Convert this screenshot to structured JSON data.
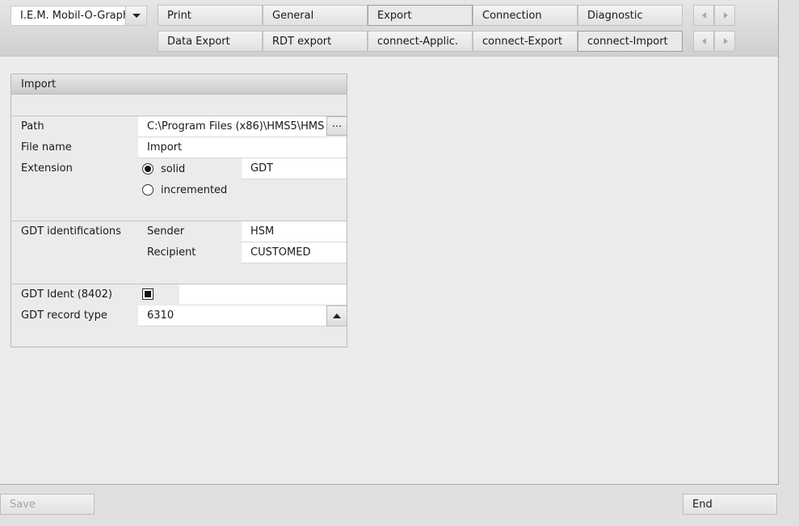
{
  "device": {
    "selected": "I.E.M. Mobil-O-Graph"
  },
  "tabs_row1": [
    "Print",
    "General",
    "Export",
    "Connection",
    "Diagnostic"
  ],
  "tabs_row2": [
    "Data Export",
    "RDT export",
    "connect-Applic.",
    "connect-Export",
    "connect-Import"
  ],
  "active_tab_row1": "Export",
  "active_tab_row2": "connect-Import",
  "panel": {
    "title": "Import",
    "path_label": "Path",
    "path_value": "C:\\Program Files (x86)\\HMS5\\HMS",
    "browse_label": "...",
    "filename_label": "File name",
    "filename_value": "Import",
    "extension_label": "Extension",
    "ext_solid_label": "solid",
    "ext_solid_selected": true,
    "ext_incremented_label": "incremented",
    "ext_value": "GDT",
    "gdt_ident_label": "GDT identifications",
    "sender_label": "Sender",
    "sender_value": "HSM",
    "recipient_label": "Recipient",
    "recipient_value": "CUSTOMED",
    "gdt_ident_8402_label": "GDT Ident (8402)",
    "gdt_ident_8402_checked": true,
    "gdt_record_type_label": "GDT record type",
    "gdt_record_type_value": "6310"
  },
  "buttons": {
    "save": "Save",
    "end": "End"
  }
}
